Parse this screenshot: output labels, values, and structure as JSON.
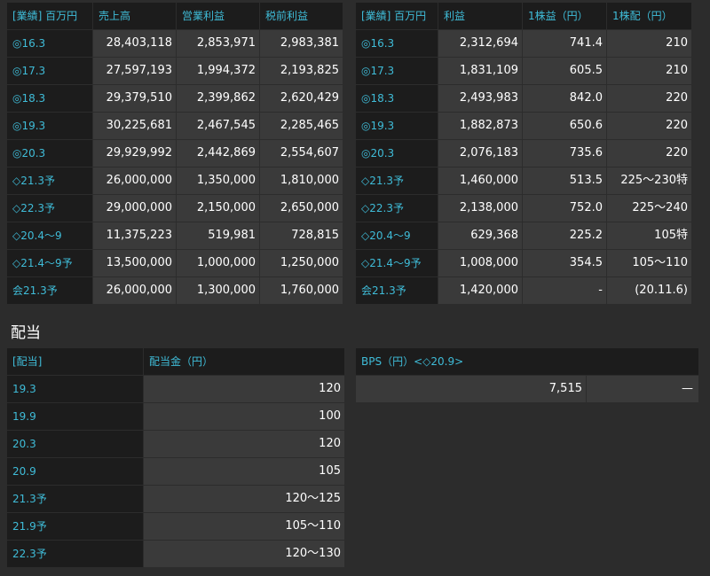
{
  "performance": {
    "left_headers": [
      "[業績] 百万円",
      "売上高",
      "営業利益",
      "税前利益"
    ],
    "right_headers": [
      "[業績] 百万円",
      "利益",
      "1株益（円）",
      "1株配（円）"
    ],
    "rows": [
      {
        "label": "◎16.3",
        "sales": "28,403,118",
        "operating_profit": "2,853,971",
        "pretax_profit": "2,983,381",
        "net_profit": "2,312,694",
        "eps": "741.4",
        "dps": "210"
      },
      {
        "label": "◎17.3",
        "sales": "27,597,193",
        "operating_profit": "1,994,372",
        "pretax_profit": "2,193,825",
        "net_profit": "1,831,109",
        "eps": "605.5",
        "dps": "210"
      },
      {
        "label": "◎18.3",
        "sales": "29,379,510",
        "operating_profit": "2,399,862",
        "pretax_profit": "2,620,429",
        "net_profit": "2,493,983",
        "eps": "842.0",
        "dps": "220"
      },
      {
        "label": "◎19.3",
        "sales": "30,225,681",
        "operating_profit": "2,467,545",
        "pretax_profit": "2,285,465",
        "net_profit": "1,882,873",
        "eps": "650.6",
        "dps": "220"
      },
      {
        "label": "◎20.3",
        "sales": "29,929,992",
        "operating_profit": "2,442,869",
        "pretax_profit": "2,554,607",
        "net_profit": "2,076,183",
        "eps": "735.6",
        "dps": "220"
      },
      {
        "label": "◇21.3予",
        "sales": "26,000,000",
        "operating_profit": "1,350,000",
        "pretax_profit": "1,810,000",
        "net_profit": "1,460,000",
        "eps": "513.5",
        "dps": "225〜230特"
      },
      {
        "label": "◇22.3予",
        "sales": "29,000,000",
        "operating_profit": "2,150,000",
        "pretax_profit": "2,650,000",
        "net_profit": "2,138,000",
        "eps": "752.0",
        "dps": "225〜240"
      },
      {
        "label": "◇20.4〜9",
        "sales": "11,375,223",
        "operating_profit": "519,981",
        "pretax_profit": "728,815",
        "net_profit": "629,368",
        "eps": "225.2",
        "dps": "105特"
      },
      {
        "label": "◇21.4〜9予",
        "sales": "13,500,000",
        "operating_profit": "1,000,000",
        "pretax_profit": "1,250,000",
        "net_profit": "1,008,000",
        "eps": "354.5",
        "dps": "105〜110"
      },
      {
        "label": "会21.3予",
        "sales": "26,000,000",
        "operating_profit": "1,300,000",
        "pretax_profit": "1,760,000",
        "net_profit": "1,420,000",
        "eps": "-",
        "dps": "(20.11.6)"
      }
    ]
  },
  "dividend": {
    "section_title": "配当",
    "headers": [
      "[配当]",
      "配当金（円）"
    ],
    "rows": [
      {
        "label": "19.3",
        "amount": "120"
      },
      {
        "label": "19.9",
        "amount": "100"
      },
      {
        "label": "20.3",
        "amount": "120"
      },
      {
        "label": "20.9",
        "amount": "105"
      },
      {
        "label": "21.3予",
        "amount": "120〜125"
      },
      {
        "label": "21.9予",
        "amount": "105〜110"
      },
      {
        "label": "22.3予",
        "amount": "120〜130"
      }
    ]
  },
  "bps": {
    "header": "BPS（円）<◇20.9>",
    "value": "7,515",
    "extra": "—"
  },
  "colors": {
    "background": "#2c2c2c",
    "header_bg": "#1c1c1c",
    "cell_bg": "#3a3a3a",
    "label_color": "#3fbcd8",
    "value_color": "#ffffff"
  }
}
